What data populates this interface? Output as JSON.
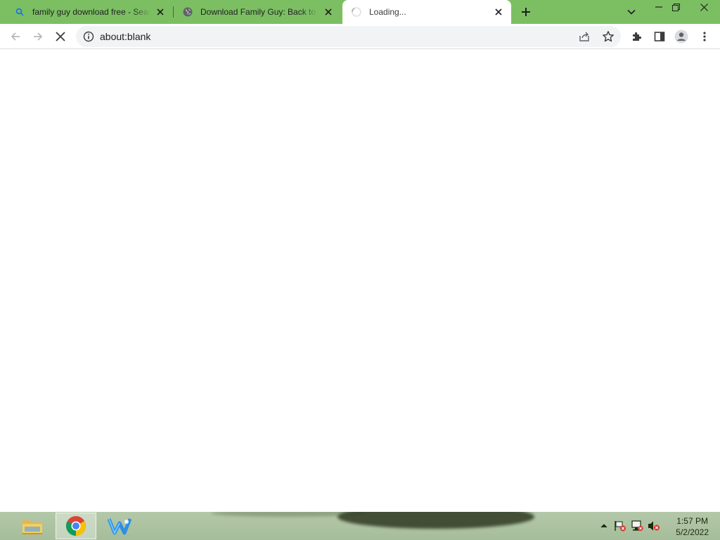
{
  "browser": {
    "tabs": [
      {
        "title": "family guy download free - Search",
        "favicon": "search-icon",
        "active": false
      },
      {
        "title": "Download Family Guy: Back to the Multiverse",
        "favicon": "globe-icon",
        "active": false
      },
      {
        "title": "Loading...",
        "favicon": "loading-spinner-icon",
        "active": true
      }
    ],
    "address": "about:blank",
    "frame_color": "#7cbf63"
  },
  "taskbar": {
    "apps": [
      "file-explorer-icon",
      "chrome-icon",
      "installer-app-icon"
    ],
    "tray_icons": [
      "show-hidden-icons",
      "action-center-flag-icon",
      "network-icon",
      "volume-muted-icon"
    ],
    "time": "1:57 PM",
    "date": "5/2/2022"
  }
}
